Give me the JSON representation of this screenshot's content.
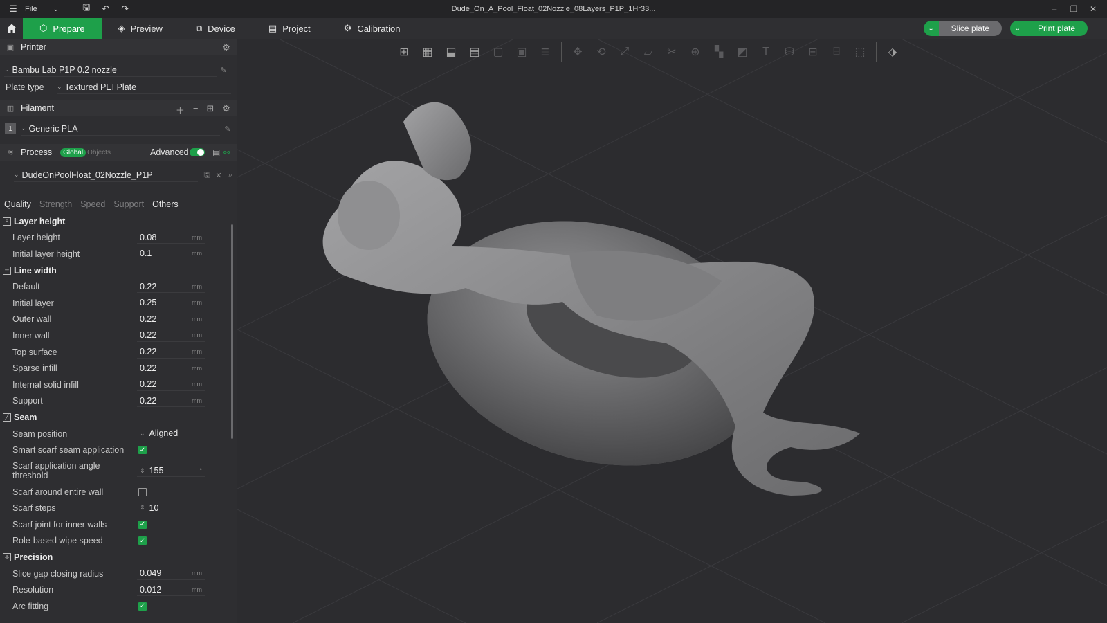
{
  "window": {
    "title": "Dude_On_A_Pool_Float_02Nozzle_08Layers_P1P_1Hr33...",
    "menu_label": "File"
  },
  "nav": {
    "tabs": [
      {
        "label": "Prepare",
        "active": true
      },
      {
        "label": "Preview"
      },
      {
        "label": "Device"
      },
      {
        "label": "Project"
      },
      {
        "label": "Calibration"
      }
    ],
    "slice_button": "Slice plate",
    "print_button": "Print plate"
  },
  "printer": {
    "section_label": "Printer",
    "name": "Bambu Lab P1P 0.2 nozzle",
    "plate_type_label": "Plate type",
    "plate_type_value": "Textured PEI Plate"
  },
  "filament": {
    "section_label": "Filament",
    "slot_number": "1",
    "name": "Generic PLA"
  },
  "process": {
    "section_label": "Process",
    "global_label": "Global",
    "objects_label": "Objects",
    "advanced_label": "Advanced",
    "advanced_on": true,
    "profile_name": "DudeOnPoolFloat_02Nozzle_P1P"
  },
  "tabs": [
    "Quality",
    "Strength",
    "Speed",
    "Support",
    "Others"
  ],
  "groups": {
    "layer_height": {
      "title": "Layer height",
      "rows": [
        {
          "label": "Layer height",
          "value": "0.08",
          "unit": "mm"
        },
        {
          "label": "Initial layer height",
          "value": "0.1",
          "unit": "mm"
        }
      ]
    },
    "line_width": {
      "title": "Line width",
      "rows": [
        {
          "label": "Default",
          "value": "0.22",
          "unit": "mm"
        },
        {
          "label": "Initial layer",
          "value": "0.25",
          "unit": "mm"
        },
        {
          "label": "Outer wall",
          "value": "0.22",
          "unit": "mm"
        },
        {
          "label": "Inner wall",
          "value": "0.22",
          "unit": "mm"
        },
        {
          "label": "Top surface",
          "value": "0.22",
          "unit": "mm"
        },
        {
          "label": "Sparse infill",
          "value": "0.22",
          "unit": "mm"
        },
        {
          "label": "Internal solid infill",
          "value": "0.22",
          "unit": "mm"
        },
        {
          "label": "Support",
          "value": "0.22",
          "unit": "mm"
        }
      ]
    },
    "seam": {
      "title": "Seam",
      "position_label": "Seam position",
      "position_value": "Aligned",
      "smart_scarf_label": "Smart scarf seam application",
      "smart_scarf_checked": true,
      "angle_label_1": "Scarf application angle",
      "angle_label_2": "threshold",
      "angle_value": "155",
      "angle_unit": "°",
      "around_label": "Scarf around entire wall",
      "around_checked": false,
      "steps_label": "Scarf steps",
      "steps_value": "10",
      "inner_label": "Scarf joint for inner walls",
      "inner_checked": true,
      "wipe_label": "Role-based wipe speed",
      "wipe_checked": true
    },
    "precision": {
      "title": "Precision",
      "gap_label": "Slice gap closing radius",
      "gap_value": "0.049",
      "res_label": "Resolution",
      "res_value": "0.012",
      "unit": "mm",
      "arc_label": "Arc fitting",
      "arc_checked": true
    }
  },
  "colors": {
    "accent": "#1ea04a",
    "panel": "#2e2e31",
    "viewport": "#2c2c2f"
  }
}
